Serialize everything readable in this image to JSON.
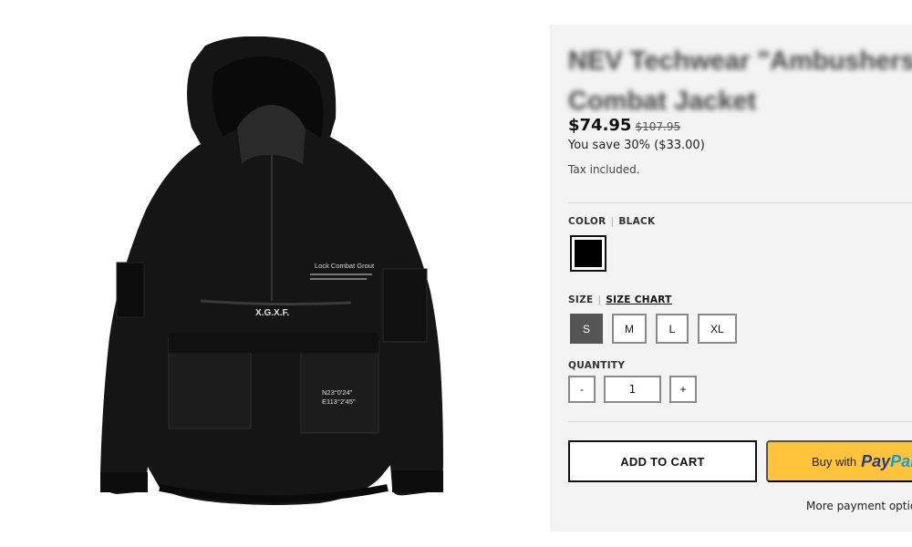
{
  "product": {
    "title_line1": "NEV Techwear \"Ambushers\"",
    "title_line2": "Combat Jacket",
    "image_icon": "hooded-jacket-image",
    "image_text": {
      "chest": "Lock Combat Grout",
      "brand": "X.G.X.F.",
      "coord1": "N23°0'24\"",
      "coord2": "E113°2'45\""
    }
  },
  "pricing": {
    "price": "$74.95",
    "compare_at": "$107.95",
    "savings": "You save 30% ($33.00)",
    "tax_note": "Tax included."
  },
  "options": {
    "color": {
      "label": "COLOR",
      "separator": "|",
      "selected": "BLACK",
      "swatch_color": "#000000"
    },
    "size": {
      "label": "SIZE",
      "separator": "|",
      "chart_link": "SIZE CHART",
      "values": [
        "S",
        "M",
        "L",
        "XL"
      ],
      "selected": "S"
    },
    "quantity": {
      "label": "QUANTITY",
      "minus": "-",
      "plus": "+",
      "value": "1"
    }
  },
  "actions": {
    "add_to_cart": "ADD TO CART",
    "paypal_prefix": "Buy with",
    "paypal_logo_a": "Pay",
    "paypal_logo_b": "Pal",
    "more_payment": "More payment options"
  },
  "colors": {
    "panel_bg": "#f3f3f3",
    "selected_size_bg": "#555555",
    "paypal_yellow": "#ffc439",
    "paypal_navy": "#253b80",
    "paypal_blue": "#179bd7"
  }
}
